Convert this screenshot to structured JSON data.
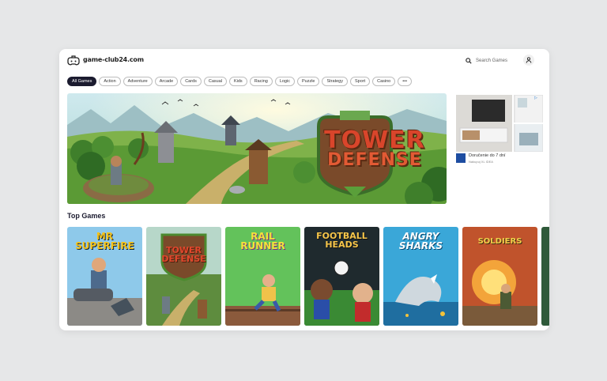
{
  "site": {
    "name": "game-club24.com"
  },
  "search": {
    "placeholder": "Search Games"
  },
  "categories": [
    "All Games",
    "Action",
    "Adventure",
    "Arcade",
    "Cards",
    "Casual",
    "Kids",
    "Racing",
    "Logic",
    "Puzzle",
    "Strategy",
    "Sport",
    "Casino"
  ],
  "more_label": "•••",
  "hero": {
    "title_line1": "TOWER",
    "title_line2": "DEFENSE"
  },
  "ad": {
    "title": "Doručenie do 7 dní",
    "subtitle": "Nakupuj XL IDEA",
    "badge": "▷"
  },
  "top_games": {
    "heading": "Top Games",
    "items": [
      {
        "title": "MR\nSUPERFIRE",
        "bg": "#8ec9ea"
      },
      {
        "title": "TOWER\nDEFENSE",
        "bg": "#5e8c3e"
      },
      {
        "title": "RAIL\nRUNNER",
        "bg": "#63c25b"
      },
      {
        "title": "FOOTBALL\nHEADS",
        "bg": "#1f2a2e"
      },
      {
        "title": "ANGRY\nSHARKS",
        "bg": "#3aa7d8"
      },
      {
        "title": "SOLDIERS",
        "bg": "#c0532c"
      }
    ]
  },
  "colors": {
    "accent": "#1b1b2f",
    "hero_title": "#d9452b"
  }
}
